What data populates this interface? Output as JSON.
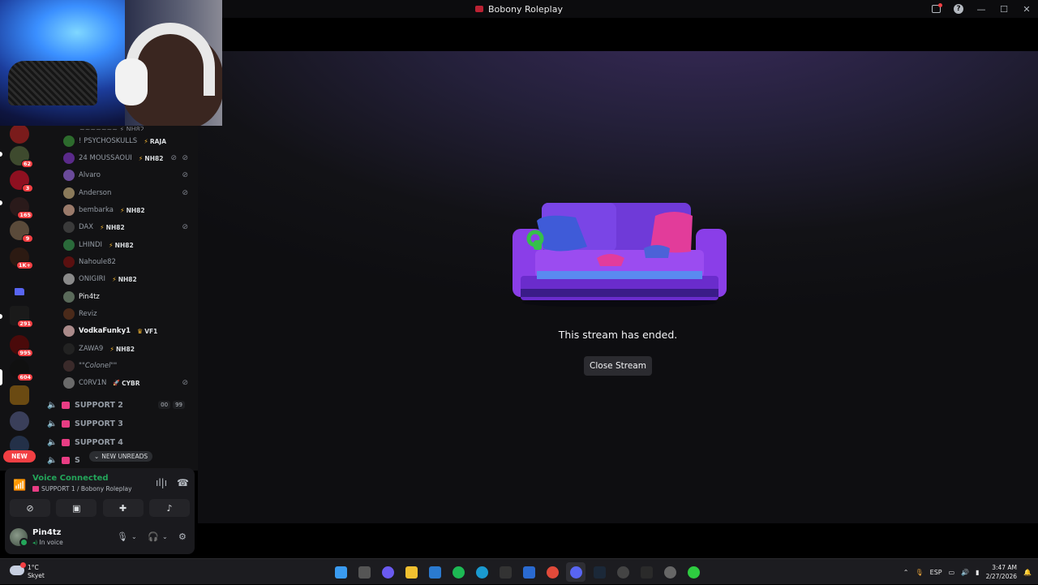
{
  "window": {
    "title": "Bobony Roleplay"
  },
  "stream": {
    "message": "This stream has ended.",
    "close_button": "Close Stream"
  },
  "server_rail": {
    "badges": [
      "62",
      "3",
      "165",
      "9",
      "1K+",
      "291",
      "995",
      "604"
    ],
    "new_label": "NEW"
  },
  "voice_members": [
    {
      "name": "! PSYCHOSKULLS",
      "tag": "RAJA"
    },
    {
      "name": "24 MOUSSAOUI",
      "tag": "NH82"
    },
    {
      "name": "Alvaro",
      "tag": ""
    },
    {
      "name": "Anderson",
      "tag": ""
    },
    {
      "name": "bembarka",
      "tag": "NH82"
    },
    {
      "name": "DAX",
      "tag": "NH82"
    },
    {
      "name": "LHINDI",
      "tag": "NH82"
    },
    {
      "name": "Nahoule82",
      "tag": ""
    },
    {
      "name": "ONIGIRI",
      "tag": "NH82"
    },
    {
      "name": "Pin4tz",
      "tag": ""
    },
    {
      "name": "Reviz",
      "tag": ""
    },
    {
      "name": "VodkaFunky1",
      "tag": "VF1"
    },
    {
      "name": "ZAWA9",
      "tag": "NH82"
    },
    {
      "name": "\"\"Colonel\"\"",
      "tag": ""
    },
    {
      "name": "C0RV1N",
      "tag": "CYBR"
    }
  ],
  "voice_channels": [
    {
      "name": "SUPPORT 2",
      "count_a": "00",
      "count_b": "99"
    },
    {
      "name": "SUPPORT 3"
    },
    {
      "name": "SUPPORT 4"
    },
    {
      "name": "S"
    }
  ],
  "new_unreads": "NEW UNREADS",
  "voice_panel": {
    "status": "Voice Connected",
    "channel": "SUPPORT 1 / Bobony Roleplay"
  },
  "user": {
    "name": "Pin4tz",
    "status": "In voice"
  },
  "taskbar": {
    "temperature": "1°C",
    "location": "Skyet",
    "language": "ESP",
    "time": "3:47 AM",
    "date": "2/27/2026"
  },
  "colors": {
    "accent": "#5865f2",
    "green": "#23a55a",
    "red": "#f23f43",
    "pink": "#e83d84"
  },
  "icons": [
    "minimize-icon",
    "maximize-icon",
    "close-icon",
    "inbox-icon",
    "help-icon",
    "speaker-icon",
    "signal-icon",
    "noise-icon",
    "disconnect-icon",
    "camera-off-icon",
    "screenshare-icon",
    "activities-icon",
    "soundboard-icon",
    "mic-icon",
    "headphones-icon",
    "settings-icon"
  ]
}
